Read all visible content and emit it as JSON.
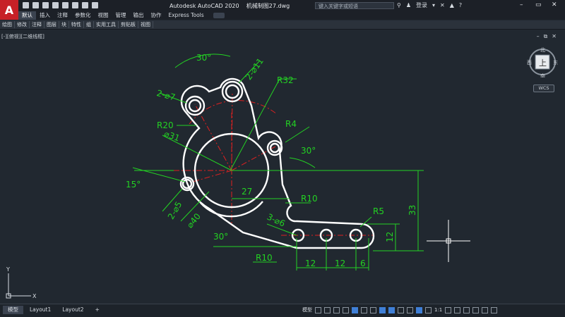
{
  "app": {
    "logo_letter": "A",
    "title": "Autodesk AutoCAD 2020",
    "document": "机械制图27.dwg",
    "search_placeholder": "键入关键字或短语",
    "login_label": "登录"
  },
  "menu": {
    "items": [
      "默认",
      "插入",
      "注释",
      "参数化",
      "视图",
      "管理",
      "输出",
      "协作",
      "Express Tools"
    ],
    "active_index": 0
  },
  "ribbon": {
    "panels": [
      "绘图",
      "修改",
      "注释",
      "图层",
      "块",
      "特性",
      "组",
      "实用工具",
      "剪贴板",
      "视图"
    ]
  },
  "viewport": {
    "control_label": "[-][俯视][二维线框]"
  },
  "viewcube": {
    "top_face": "上",
    "north": "北",
    "south": "南",
    "east": "东",
    "west": "西",
    "wcs_label": "WCS"
  },
  "drawing": {
    "dims": {
      "ang30_top": "30°",
      "d11": "2-⌀11",
      "r32": "R32",
      "d7": "2-⌀7",
      "r20": "R20",
      "r4": "R4",
      "d31": "⌀31",
      "ang30_right": "30°",
      "ang15": "15°",
      "d5": "2-⌀5",
      "d27": "27",
      "r10_upper": "R10",
      "d40": "⌀40",
      "d6": "3-⌀6",
      "r5": "R5",
      "h33": "33",
      "h12": "12",
      "ang30_bottom": "30°",
      "r10_lower": "R10",
      "w12a": "12",
      "w12b": "12",
      "w6": "6"
    },
    "ucs_y": "Y",
    "ucs_x": "X"
  },
  "status": {
    "tabs": [
      "模型",
      "Layout1",
      "Layout2"
    ],
    "add_tab": "+",
    "model_label": "模型",
    "scale": "1:1"
  },
  "colors": {
    "geometry": "#ffffff",
    "dimension": "#23d223",
    "centerline": "#e02020",
    "background": "#212830"
  }
}
